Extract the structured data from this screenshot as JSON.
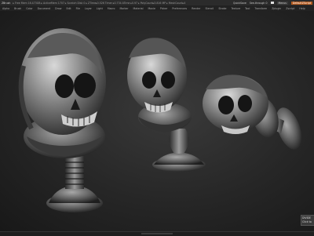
{
  "title_bar": {
    "app_name": "ZBrush",
    "info_text": "▸ Free Mem 16.473GB ▸ ActiveMem 1707 ▸ Scratch Disk 0 ▸ ZTime▸0.526 Timer ▸0.734 ATime ▸0.97 ▸ PolyCount▸3.816 MP ▸ MeshCount▸4",
    "quicksave_label": "QuickSave",
    "see_through_label": "See-through 0",
    "menus_label": "Menus",
    "default_zscript_label": "DefaultZScript"
  },
  "menu_bar": {
    "items": [
      "Alpha",
      "Brush",
      "Color",
      "Document",
      "Draw",
      "Edit",
      "File",
      "Layer",
      "Light",
      "Macro",
      "Marker",
      "Material",
      "Movie",
      "Picker",
      "Preferences",
      "Render",
      "Stencil",
      "Stroke",
      "Texture",
      "Tool",
      "Transform",
      "Zplugin",
      "Zscript",
      "Help"
    ]
  },
  "divide_panel": {
    "title": "DIVIDE",
    "subtitle": "Click to"
  },
  "colors": {
    "background": "#141414",
    "title_bar": "#2b2b2b",
    "menu_bar": "#222222",
    "accent_orange": "#b35a1f",
    "sculpt_material": "#8a8a8a"
  }
}
